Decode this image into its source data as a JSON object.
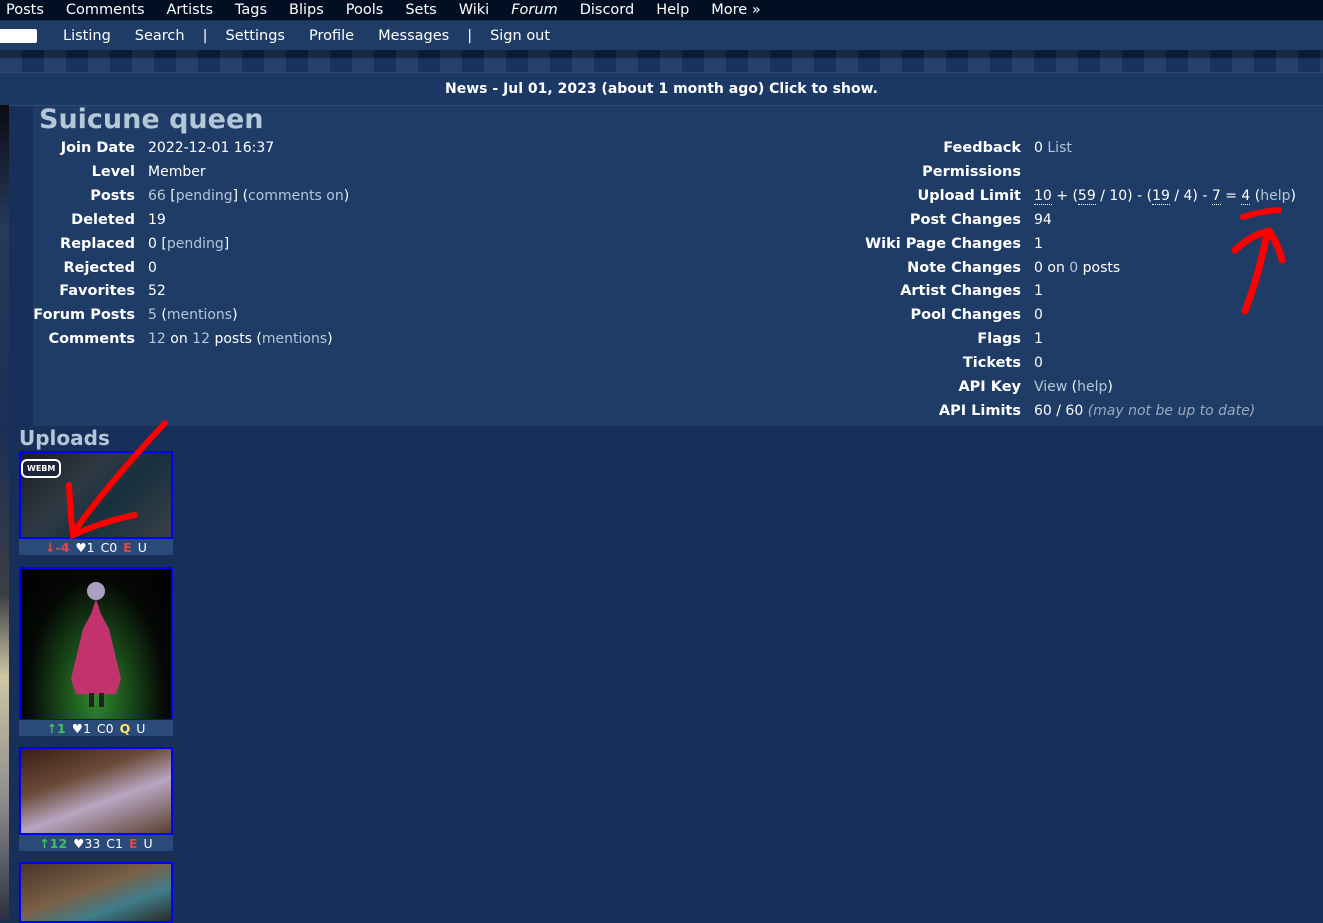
{
  "nav_main": [
    "Posts",
    "Comments",
    "Artists",
    "Tags",
    "Blips",
    "Pools",
    "Sets",
    "Wiki",
    "Forum",
    "Discord",
    "Help",
    "More »"
  ],
  "nav_sub": {
    "items_left": [
      "Listing",
      "Search"
    ],
    "items_mid": [
      "Settings",
      "Profile",
      "Messages"
    ],
    "items_right": [
      "Sign out"
    ],
    "separator": "|"
  },
  "news": "News - Jul 01, 2023 (about 1 month ago) Click to show.",
  "profile": {
    "username": "Suicune queen",
    "left": [
      {
        "label": "Join Date",
        "value": "2022-12-01 16:37"
      },
      {
        "label": "Level",
        "value": "Member"
      },
      {
        "label": "Posts",
        "parts": [
          "66",
          " [",
          "pending",
          "] (",
          "comments on",
          ")"
        ]
      },
      {
        "label": "Deleted",
        "value": "19"
      },
      {
        "label": "Replaced",
        "parts": [
          "0",
          " [",
          "pending",
          "]"
        ]
      },
      {
        "label": "Rejected",
        "value": "0"
      },
      {
        "label": "Favorites",
        "value": "52"
      },
      {
        "label": "Forum Posts",
        "parts": [
          "5",
          " (",
          "mentions",
          ")"
        ]
      },
      {
        "label": "Comments",
        "parts": [
          "12",
          " on ",
          "12",
          " posts (",
          "mentions",
          ")"
        ]
      }
    ],
    "right": [
      {
        "label": "Feedback",
        "parts": [
          "0",
          " ",
          "List"
        ]
      },
      {
        "label": "Permissions",
        "value": ""
      },
      {
        "label": "Upload Limit",
        "parts": [
          "10",
          " + (",
          "59",
          " / 10) - (",
          "19",
          " / 4) - ",
          "7",
          " = ",
          "4",
          " (",
          "help",
          ")"
        ]
      },
      {
        "label": "Post Changes",
        "value": "94"
      },
      {
        "label": "Wiki Page Changes",
        "value": "1"
      },
      {
        "label": "Note Changes",
        "parts": [
          "0",
          " on ",
          "0",
          " posts"
        ]
      },
      {
        "label": "Artist Changes",
        "value": "1"
      },
      {
        "label": "Pool Changes",
        "value": "0"
      },
      {
        "label": "Flags",
        "value": "1"
      },
      {
        "label": "Tickets",
        "value": "0"
      },
      {
        "label": "API Key",
        "parts": [
          "View",
          " (",
          "help",
          ")"
        ]
      },
      {
        "label": "API Limits",
        "parts": [
          "60 / 60 ",
          "(may not be up to date)"
        ]
      }
    ]
  },
  "uploads": {
    "title": "Uploads",
    "posts": [
      {
        "badge": "WEBM",
        "score": "↓-4",
        "favs": "♥1",
        "comments": "C0",
        "rating": "E",
        "status": "U"
      },
      {
        "badge": "",
        "score": "↑1",
        "favs": "♥1",
        "comments": "C0",
        "rating": "Q",
        "status": "U"
      },
      {
        "badge": "",
        "score": "↑12",
        "favs": "♥33",
        "comments": "C1",
        "rating": "E",
        "status": "U"
      },
      {
        "badge": "",
        "score": "",
        "favs": "",
        "comments": "",
        "rating": "",
        "status": ""
      }
    ]
  },
  "colors": {
    "background": "#183059",
    "panel": "#1f3c67",
    "link": "#b4c7d9",
    "nav": "#020f23",
    "annotation": "#ff0000"
  }
}
